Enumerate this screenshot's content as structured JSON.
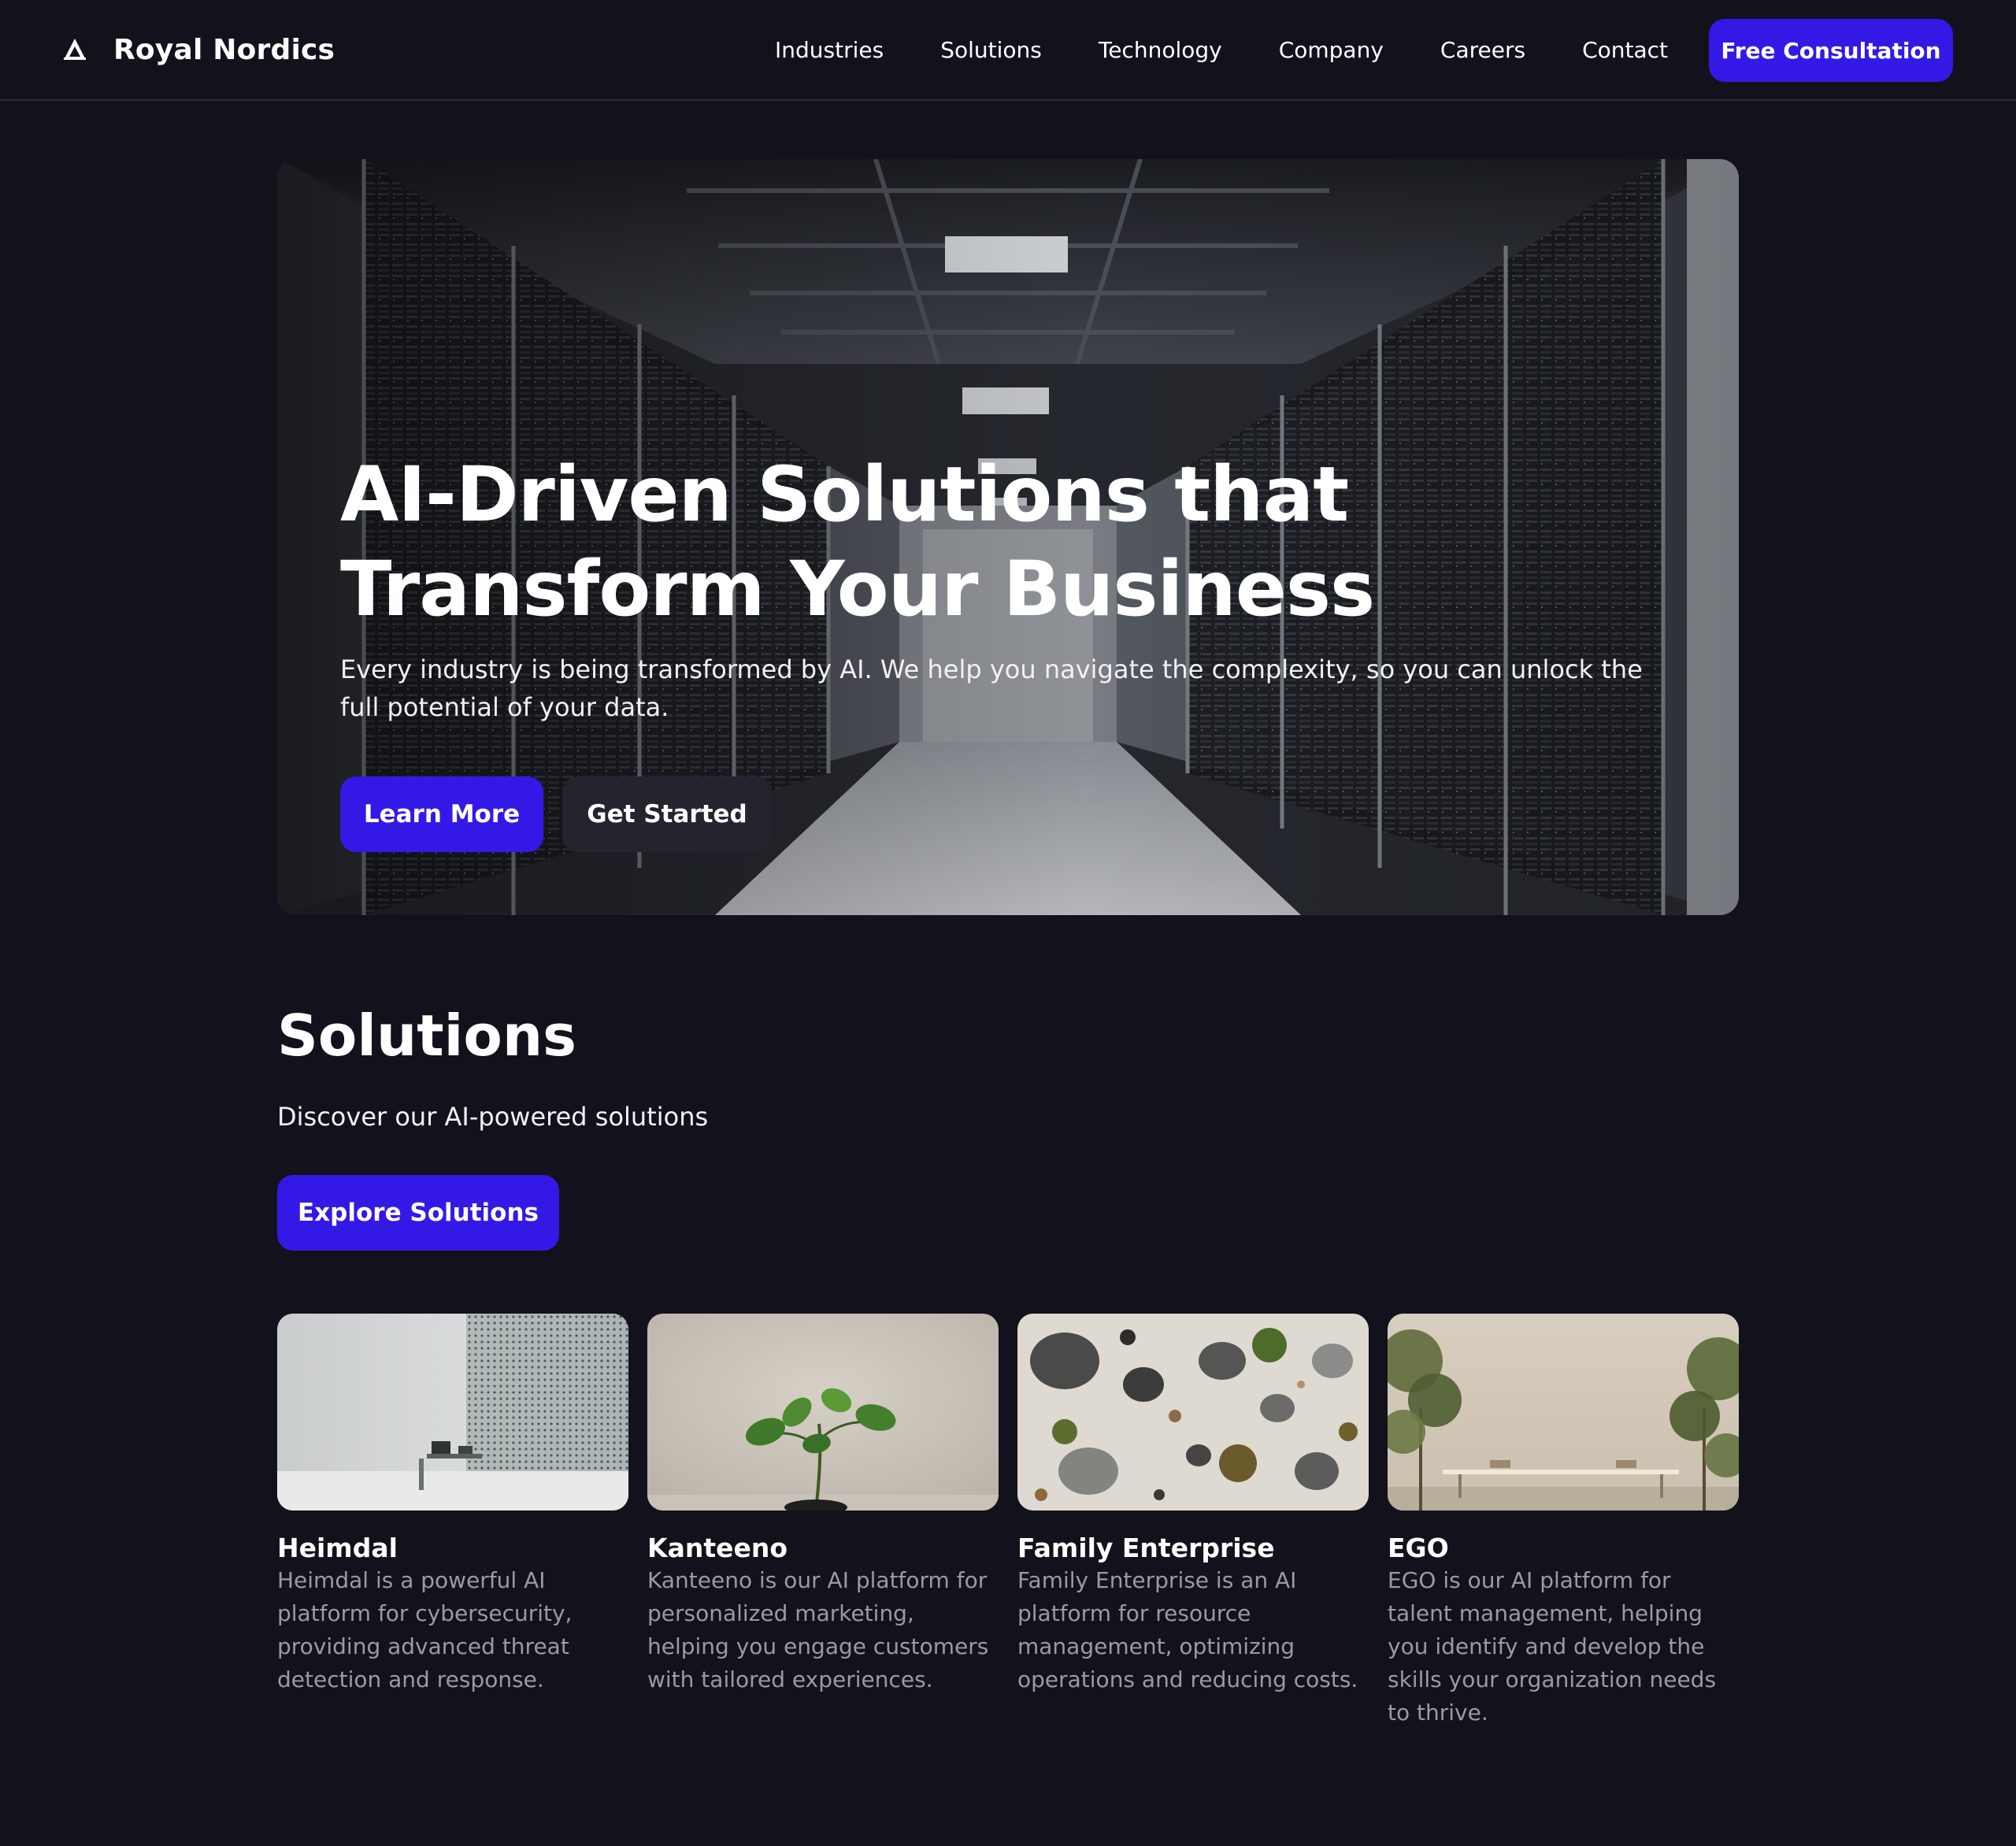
{
  "nav": {
    "brand": "Royal Nordics",
    "links": [
      "Industries",
      "Solutions",
      "Technology",
      "Company",
      "Careers",
      "Contact"
    ],
    "cta": "Free Consultation"
  },
  "hero": {
    "title": "AI-Driven Solutions that Transform Your Business",
    "subtitle": "Every industry is being transformed by AI. We help you navigate the complexity, so you can unlock the full potential of your data.",
    "primary_button": "Learn More",
    "secondary_button": "Get Started"
  },
  "solutions": {
    "title": "Solutions",
    "subtitle": "Discover our AI-powered solutions",
    "button": "Explore Solutions",
    "cards": [
      {
        "title": "Heimdal",
        "description": "Heimdal is a powerful AI platform for cybersecurity, providing advanced threat detection and response."
      },
      {
        "title": "Kanteeno",
        "description": "Kanteeno is our AI platform for personalized marketing, helping you engage customers with tailored experiences."
      },
      {
        "title": "Family Enterprise",
        "description": "Family Enterprise is an AI platform for resource management, optimizing operations and reducing costs."
      },
      {
        "title": "EGO",
        "description": "EGO is our AI platform for talent management, helping you identify and develop the skills your organization needs to thrive."
      }
    ]
  },
  "colors": {
    "background": "#13121c",
    "accent": "#3419e6",
    "secondary_button": "#24232e",
    "muted_text": "#9a99a6"
  },
  "icons": {
    "brand_logo": "triangle-logo-icon"
  }
}
